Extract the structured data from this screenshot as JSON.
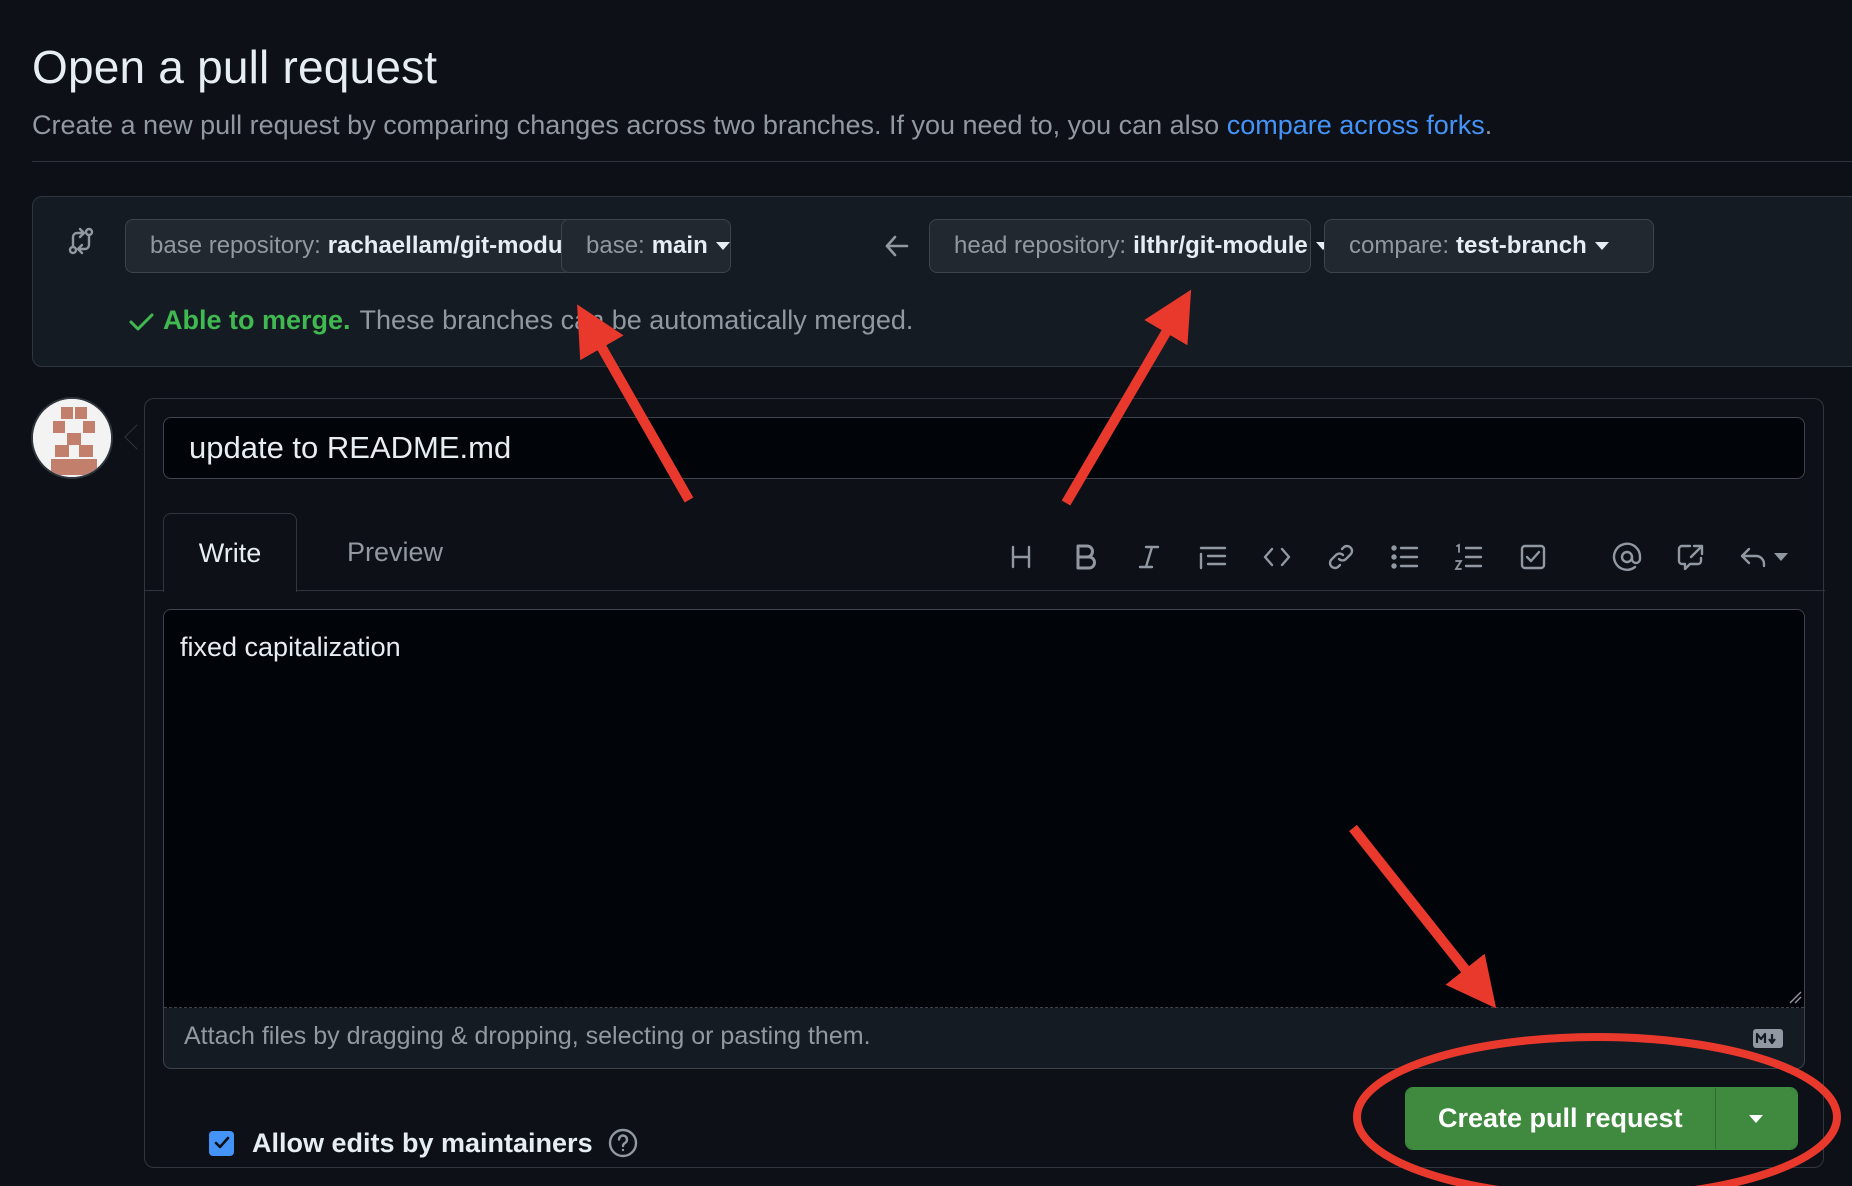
{
  "page": {
    "title": "Open a pull request",
    "subtitle_text": "Create a new pull request by comparing changes across two branches. If you need to, you can also ",
    "subtitle_link": "compare across forks",
    "subtitle_end": "."
  },
  "compare": {
    "base_repo_label": "base repository:",
    "base_repo_value": "rachaellam/git-module",
    "base_label": "base:",
    "base_value": "main",
    "head_repo_label": "head repository:",
    "head_repo_value": "ilthr/git-module",
    "compare_label": "compare:",
    "compare_value": "test-branch",
    "merge_ok": "Able to merge.",
    "merge_text": "These branches can be automatically merged."
  },
  "form": {
    "title_value": "update to README.md",
    "tabs": [
      "Write",
      "Preview"
    ],
    "body_value": "fixed capitalization",
    "attach_hint": "Attach files by dragging & dropping, selecting or pasting them.",
    "allow_edits_label": "Allow edits by maintainers",
    "allow_edits_checked": true,
    "create_button": "Create pull request"
  },
  "toolbar": {
    "icons": [
      "heading-icon",
      "bold-icon",
      "italic-icon",
      "quote-icon",
      "code-icon",
      "link-icon",
      "unordered-list-icon",
      "ordered-list-icon",
      "task-list-icon",
      "mention-icon",
      "cross-reference-icon",
      "reply-icon"
    ]
  },
  "colors": {
    "background": "#0d1117",
    "link": "#4493f8",
    "success": "#3fb950",
    "button_green": "#3f8a3f",
    "annotation_red": "#e8392c"
  }
}
